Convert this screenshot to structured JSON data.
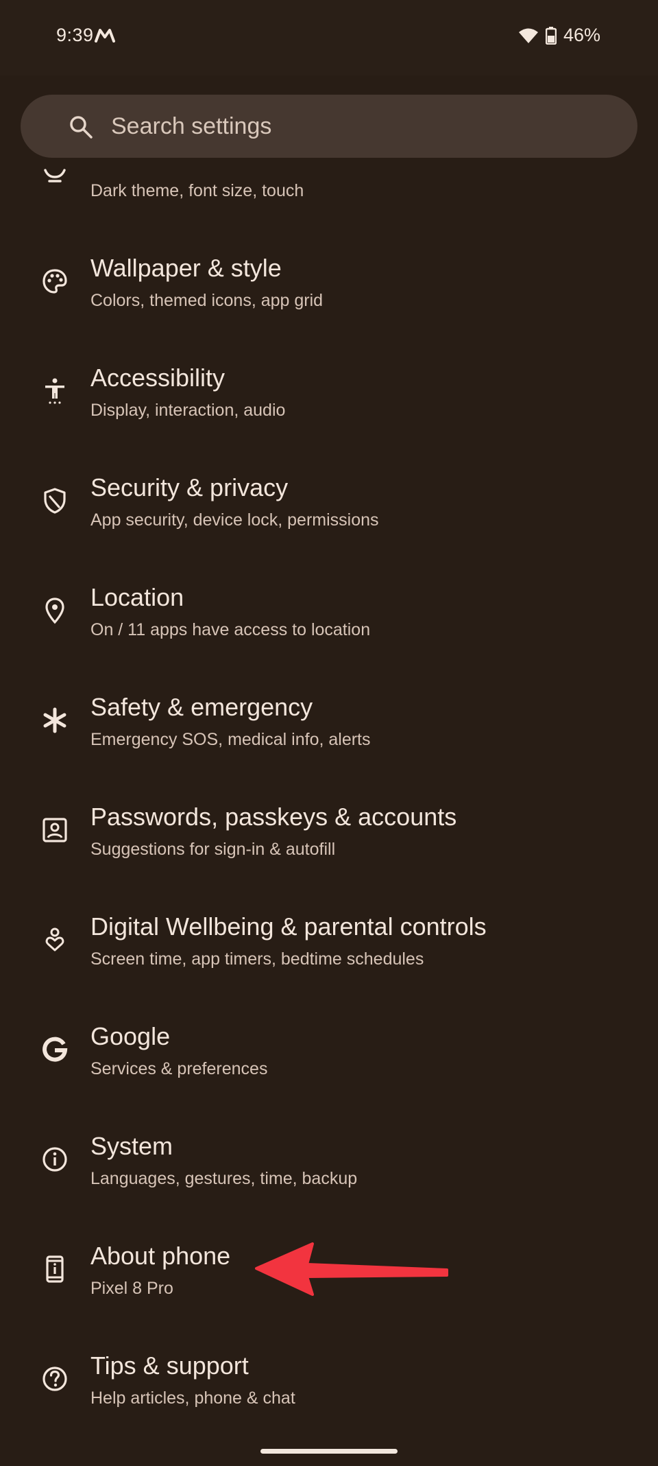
{
  "status_bar": {
    "time": "9:39",
    "battery_percent": "46%"
  },
  "search": {
    "placeholder": "Search settings"
  },
  "partial_item": {
    "subtitle": "Dark theme, font size, touch",
    "icon": "display-icon"
  },
  "items": [
    {
      "title": "Wallpaper & style",
      "subtitle": "Colors, themed icons, app grid",
      "icon": "palette-icon"
    },
    {
      "title": "Accessibility",
      "subtitle": "Display, interaction, audio",
      "icon": "accessibility-icon"
    },
    {
      "title": "Security & privacy",
      "subtitle": "App security, device lock, permissions",
      "icon": "shield-icon"
    },
    {
      "title": "Location",
      "subtitle": "On / 11 apps have access to location",
      "icon": "location-pin-icon"
    },
    {
      "title": "Safety & emergency",
      "subtitle": "Emergency SOS, medical info, alerts",
      "icon": "asterisk-icon"
    },
    {
      "title": "Passwords, passkeys & accounts",
      "subtitle": "Suggestions for sign-in & autofill",
      "icon": "account-box-icon"
    },
    {
      "title": "Digital Wellbeing & parental controls",
      "subtitle": "Screen time, app timers, bedtime schedules",
      "icon": "wellbeing-icon"
    },
    {
      "title": "Google",
      "subtitle": "Services & preferences",
      "icon": "google-icon"
    },
    {
      "title": "System",
      "subtitle": "Languages, gestures, time, backup",
      "icon": "info-icon"
    },
    {
      "title": "About phone",
      "subtitle": "Pixel 8 Pro",
      "icon": "phone-info-icon"
    },
    {
      "title": "Tips & support",
      "subtitle": "Help articles, phone & chat",
      "icon": "help-icon"
    }
  ],
  "colors": {
    "background": "#281d15",
    "search_bg": "#463830",
    "title_text": "#f3e6dc",
    "subtitle_text": "#d7c4b7",
    "arrow": "#f2343f"
  }
}
